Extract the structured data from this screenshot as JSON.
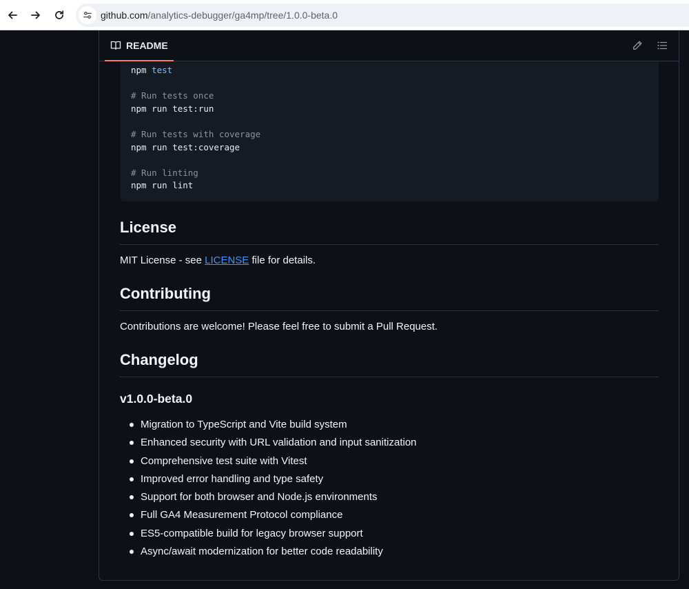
{
  "browser": {
    "url_host": "github.com",
    "url_path": "/analytics-debugger/ga4mp/tree/1.0.0-beta.0"
  },
  "readme": {
    "tab_label": "README"
  },
  "code_block": {
    "lines": [
      {
        "text": "npm ",
        "kw": "test",
        "type": "code"
      },
      {
        "text": "",
        "type": "blank"
      },
      {
        "text": "# Run tests once",
        "type": "comment"
      },
      {
        "text": "npm run test:run",
        "type": "code"
      },
      {
        "text": "",
        "type": "blank"
      },
      {
        "text": "# Run tests with coverage",
        "type": "comment"
      },
      {
        "text": "npm run test:coverage",
        "type": "code"
      },
      {
        "text": "",
        "type": "blank"
      },
      {
        "text": "# Run linting",
        "type": "comment"
      },
      {
        "text": "npm run lint",
        "type": "code"
      }
    ]
  },
  "license": {
    "heading": "License",
    "text_before": "MIT License - see ",
    "link": "LICENSE",
    "text_after": " file for details."
  },
  "contributing": {
    "heading": "Contributing",
    "text": "Contributions are welcome! Please feel free to submit a Pull Request."
  },
  "changelog": {
    "heading": "Changelog",
    "version": "v1.0.0-beta.0",
    "items": [
      "Migration to TypeScript and Vite build system",
      "Enhanced security with URL validation and input sanitization",
      "Comprehensive test suite with Vitest",
      "Improved error handling and type safety",
      "Support for both browser and Node.js environments",
      "Full GA4 Measurement Protocol compliance",
      "ES5-compatible build for legacy browser support",
      "Async/await modernization for better code readability"
    ]
  }
}
